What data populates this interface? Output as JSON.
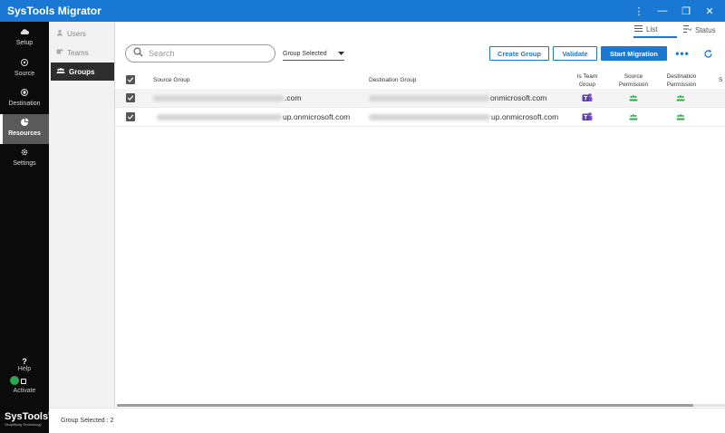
{
  "app": {
    "title": "SysTools Migrator"
  },
  "window_controls": [
    {
      "name": "more-vert-icon",
      "glyph": "⋮"
    },
    {
      "name": "minimize-icon",
      "glyph": "—"
    },
    {
      "name": "restore-icon",
      "glyph": "❐"
    },
    {
      "name": "close-icon",
      "glyph": "✕"
    }
  ],
  "leftnav": {
    "items": [
      {
        "label": "Setup",
        "icon": "cloud-icon"
      },
      {
        "label": "Source",
        "icon": "source-icon"
      },
      {
        "label": "Destination",
        "icon": "destination-icon"
      },
      {
        "label": "Resources",
        "icon": "resources-icon",
        "active": true
      },
      {
        "label": "Settings",
        "icon": "gear-icon"
      }
    ],
    "help_label": "Help",
    "activate_label": "Activate",
    "brand_name": "SysTools",
    "brand_registered": "®",
    "brand_tagline": "Simplifying Technology"
  },
  "subnav": {
    "items": [
      {
        "label": "Users",
        "icon": "user-icon"
      },
      {
        "label": "Teams",
        "icon": "teams-icon"
      },
      {
        "label": "Groups",
        "icon": "groups-icon",
        "active": true
      }
    ]
  },
  "viewtabs": {
    "list_label": "List",
    "status_label": "Status"
  },
  "toolbar": {
    "search_placeholder": "Search",
    "filter_value": "Group Selected",
    "create_group_label": "Create Group",
    "validate_label": "Validate",
    "start_migration_label": "Start Migration"
  },
  "table": {
    "columns": {
      "source_group": "Source Group",
      "destination_group": "Destination Group",
      "is_team_group_1": "Is Team",
      "is_team_group_2": "Group",
      "source_permission_1": "Source",
      "source_permission_2": "Permission",
      "destination_permission_1": "Destination",
      "destination_permission_2": "Permission",
      "cutoff": "S"
    },
    "rows": [
      {
        "checked": true,
        "source_visible": ".com",
        "destination_visible": "onmicrosoft.com",
        "is_team": true
      },
      {
        "checked": true,
        "source_visible": "up.onmicrosoft.com",
        "destination_visible": "up.onmicrosoft.com",
        "is_team": true
      }
    ]
  },
  "colors": {
    "accent": "#1a78d5",
    "teams_purple": "#7b4fc9",
    "permission_green": "#2ea84a",
    "nav_bg": "#0b0b0b"
  },
  "statusbar": {
    "text": "Group Selected : 2"
  }
}
